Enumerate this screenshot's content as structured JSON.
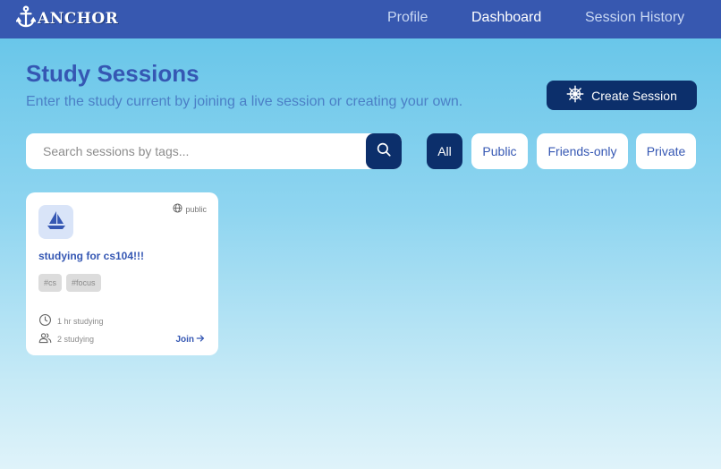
{
  "app": {
    "logo_text": "ANCHOR"
  },
  "nav": {
    "profile": "Profile",
    "dashboard": "Dashboard",
    "session_history": "Session History",
    "active": "dashboard"
  },
  "header": {
    "title": "Study Sessions",
    "subtitle": "Enter the study current by joining a live session or creating your own.",
    "create_button": "Create Session"
  },
  "search": {
    "placeholder": "Search sessions by tags..."
  },
  "filters": {
    "all": "All",
    "public": "Public",
    "friends_only": "Friends-only",
    "private": "Private",
    "selected": "All"
  },
  "sessions": [
    {
      "title": "studying for cs104!!!",
      "visibility": "public",
      "tags": [
        "#cs",
        "#focus"
      ],
      "duration": "1 hr studying",
      "participants": "2 studying",
      "join_label": "Join"
    }
  ],
  "colors": {
    "nav_bar": "#3758b0",
    "primary_dark": "#0c2f6b",
    "title_blue": "#3557b3",
    "subtitle_blue": "#4b7fc6"
  },
  "icons": {
    "logo": "anchor-icon",
    "create": "ship-wheel-icon",
    "search": "search-icon",
    "card": "sailboat-icon",
    "visibility": "globe-icon",
    "time": "clock-icon",
    "people": "users-icon",
    "join": "arrow-right-icon"
  }
}
